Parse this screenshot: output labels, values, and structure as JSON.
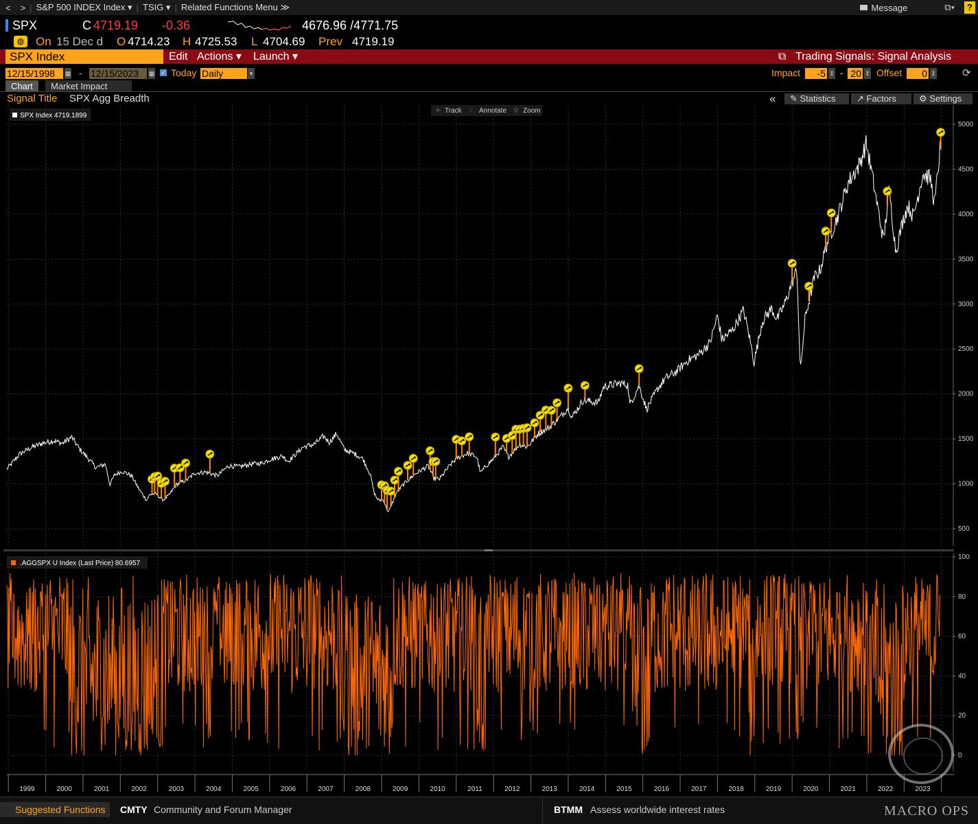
{
  "nav": {
    "back": "<",
    "forward": ">",
    "security_menu": "S&P 500 INDEX Index ▾",
    "function_menu": "TSIG ▾",
    "related": "Related Functions Menu ≫",
    "message": "Message",
    "help": "?"
  },
  "quote": {
    "ticker": "SPX",
    "close_prefix": "C",
    "close": "4719.19",
    "change": "-0.36",
    "range": "4676.96 /4771.75",
    "on_label": "On",
    "date": "15 Dec d",
    "open_label": "O",
    "open": "4714.23",
    "high_label": "H",
    "high": "4725.53",
    "low_label": "L",
    "low": "4704.69",
    "prev_label": "Prev",
    "prev": "4719.19"
  },
  "toolbar": {
    "security": "SPX Index",
    "edit": "Edit",
    "actions": "Actions ▾",
    "launch": "Launch ▾",
    "title": "Trading Signals: Signal Analysis"
  },
  "controls": {
    "start_date": "12/15/1998",
    "dash": "-",
    "end_date": "12/15/2023",
    "today_label": "Today",
    "periodicity": "Daily",
    "impact_label": "Impact",
    "impact_value": "-5",
    "dash2": "-",
    "impact_value2": "20",
    "offset_label": "Offset",
    "offset_value": "0"
  },
  "tabs": [
    "Chart",
    "Market Impact"
  ],
  "signal": {
    "title_label": "Signal Title",
    "title_value": "SPX Agg Breadth",
    "statistics": "Statistics",
    "factors": "Factors",
    "settings": "Settings"
  },
  "chart_tools": {
    "track": "Track",
    "annotate": "Annotate",
    "zoom": "Zoom"
  },
  "colors": {
    "background": "#000000",
    "price_line": "#ffffff",
    "breadth_line": "#ff6a00",
    "signal_marker": "#f5e000",
    "accent": "#ffa31a",
    "toolbar_bg": "#8b0b14"
  },
  "chart_data": [
    {
      "type": "line",
      "legend": "SPX Index 4719.1899",
      "x": [
        "1999",
        "2000",
        "2001",
        "2002",
        "2003",
        "2004",
        "2005",
        "2006",
        "2007",
        "2008",
        "2009",
        "2010",
        "2011",
        "2012",
        "2013",
        "2014",
        "2015",
        "2016",
        "2017",
        "2018",
        "2019",
        "2020",
        "2021",
        "2022",
        "2023"
      ],
      "ylim": [
        300,
        5100
      ],
      "yticks": [
        500,
        1000,
        1500,
        2000,
        2500,
        3000,
        3500,
        4000,
        4500,
        5000
      ],
      "series": [
        {
          "values": [
            [
              1998.96,
              1163
            ],
            [
              1999.3,
              1330
            ],
            [
              1999.6,
              1400
            ],
            [
              1999.9,
              1450
            ],
            [
              2000.2,
              1480
            ],
            [
              2000.45,
              1450
            ],
            [
              2000.7,
              1520
            ],
            [
              2000.9,
              1390
            ],
            [
              2001.1,
              1300
            ],
            [
              2001.35,
              1180
            ],
            [
              2001.6,
              1220
            ],
            [
              2001.72,
              990
            ],
            [
              2001.85,
              1100
            ],
            [
              2002.05,
              1140
            ],
            [
              2002.3,
              1090
            ],
            [
              2002.5,
              940
            ],
            [
              2002.7,
              820
            ],
            [
              2002.8,
              880
            ],
            [
              2002.95,
              890
            ],
            [
              2003.15,
              820
            ],
            [
              2003.3,
              870
            ],
            [
              2003.5,
              990
            ],
            [
              2003.8,
              1050
            ],
            [
              2004.0,
              1120
            ],
            [
              2004.3,
              1130
            ],
            [
              2004.6,
              1090
            ],
            [
              2004.9,
              1200
            ],
            [
              2005.2,
              1190
            ],
            [
              2005.5,
              1220
            ],
            [
              2005.8,
              1230
            ],
            [
              2006.0,
              1270
            ],
            [
              2006.35,
              1310
            ],
            [
              2006.5,
              1250
            ],
            [
              2006.9,
              1410
            ],
            [
              2007.2,
              1440
            ],
            [
              2007.45,
              1530
            ],
            [
              2007.6,
              1460
            ],
            [
              2007.8,
              1560
            ],
            [
              2008.0,
              1380
            ],
            [
              2008.3,
              1330
            ],
            [
              2008.5,
              1280
            ],
            [
              2008.7,
              1100
            ],
            [
              2008.8,
              900
            ],
            [
              2008.9,
              820
            ],
            [
              2009.05,
              820
            ],
            [
              2009.18,
              680
            ],
            [
              2009.4,
              900
            ],
            [
              2009.6,
              1000
            ],
            [
              2009.9,
              1110
            ],
            [
              2010.25,
              1200
            ],
            [
              2010.4,
              1060
            ],
            [
              2010.55,
              1050
            ],
            [
              2010.8,
              1190
            ],
            [
              2011.0,
              1280
            ],
            [
              2011.3,
              1340
            ],
            [
              2011.55,
              1300
            ],
            [
              2011.65,
              1120
            ],
            [
              2011.8,
              1200
            ],
            [
              2012.0,
              1280
            ],
            [
              2012.25,
              1410
            ],
            [
              2012.4,
              1300
            ],
            [
              2012.7,
              1440
            ],
            [
              2012.9,
              1410
            ],
            [
              2013.2,
              1560
            ],
            [
              2013.5,
              1630
            ],
            [
              2013.8,
              1750
            ],
            [
              2014.0,
              1850
            ],
            [
              2014.1,
              1740
            ],
            [
              2014.4,
              1930
            ],
            [
              2014.8,
              1900
            ],
            [
              2014.95,
              2080
            ],
            [
              2015.4,
              2120
            ],
            [
              2015.6,
              2100
            ],
            [
              2015.65,
              1880
            ],
            [
              2015.9,
              2090
            ],
            [
              2016.1,
              1830
            ],
            [
              2016.4,
              2060
            ],
            [
              2016.6,
              2170
            ],
            [
              2016.9,
              2250
            ],
            [
              2017.2,
              2370
            ],
            [
              2017.5,
              2440
            ],
            [
              2017.8,
              2570
            ],
            [
              2018.0,
              2870
            ],
            [
              2018.12,
              2600
            ],
            [
              2018.4,
              2710
            ],
            [
              2018.7,
              2930
            ],
            [
              2018.85,
              2650
            ],
            [
              2018.98,
              2350
            ],
            [
              2019.2,
              2810
            ],
            [
              2019.45,
              2950
            ],
            [
              2019.6,
              2830
            ],
            [
              2019.8,
              3000
            ],
            [
              2020.0,
              3240
            ],
            [
              2020.13,
              3380
            ],
            [
              2020.22,
              2240
            ],
            [
              2020.35,
              2850
            ],
            [
              2020.6,
              3300
            ],
            [
              2020.75,
              3380
            ],
            [
              2020.95,
              3700
            ],
            [
              2021.2,
              3950
            ],
            [
              2021.5,
              4350
            ],
            [
              2021.8,
              4550
            ],
            [
              2021.99,
              4790
            ],
            [
              2022.2,
              4300
            ],
            [
              2022.45,
              3700
            ],
            [
              2022.6,
              4280
            ],
            [
              2022.78,
              3580
            ],
            [
              2022.95,
              3900
            ],
            [
              2023.1,
              4100
            ],
            [
              2023.25,
              3970
            ],
            [
              2023.5,
              4450
            ],
            [
              2023.7,
              4400
            ],
            [
              2023.82,
              4110
            ],
            [
              2023.96,
              4719
            ]
          ]
        }
      ],
      "signals_x": [
        2002.85,
        2002.92,
        2003.0,
        2003.1,
        2003.2,
        2003.45,
        2003.6,
        2003.75,
        2004.4,
        2009.0,
        2009.08,
        2009.15,
        2009.25,
        2009.35,
        2009.45,
        2009.7,
        2009.85,
        2010.3,
        2010.38,
        2010.45,
        2011.0,
        2011.15,
        2011.35,
        2012.05,
        2012.35,
        2012.5,
        2012.6,
        2012.7,
        2012.8,
        2012.9,
        2013.1,
        2013.25,
        2013.4,
        2013.55,
        2013.7,
        2014.0,
        2014.45,
        2015.9,
        2020.0,
        2020.45,
        2020.9,
        2021.05,
        2022.55,
        2023.98
      ],
      "ylabel": ""
    },
    {
      "type": "line",
      "legend": ".AGGSPX U Index (Last Price) 80.6957",
      "ylim": [
        -10,
        100
      ],
      "yticks": [
        0,
        20,
        40,
        60,
        80,
        100
      ],
      "series": [
        {
          "values": [
            80.6957
          ]
        }
      ]
    }
  ],
  "footer": {
    "suggested": "Suggested Functions",
    "cmd1": "CMTY",
    "desc1": "Community and Forum Manager",
    "cmd2": "BTMM",
    "desc2": "Assess worldwide interest rates",
    "watermark": "MACRO OPS"
  }
}
